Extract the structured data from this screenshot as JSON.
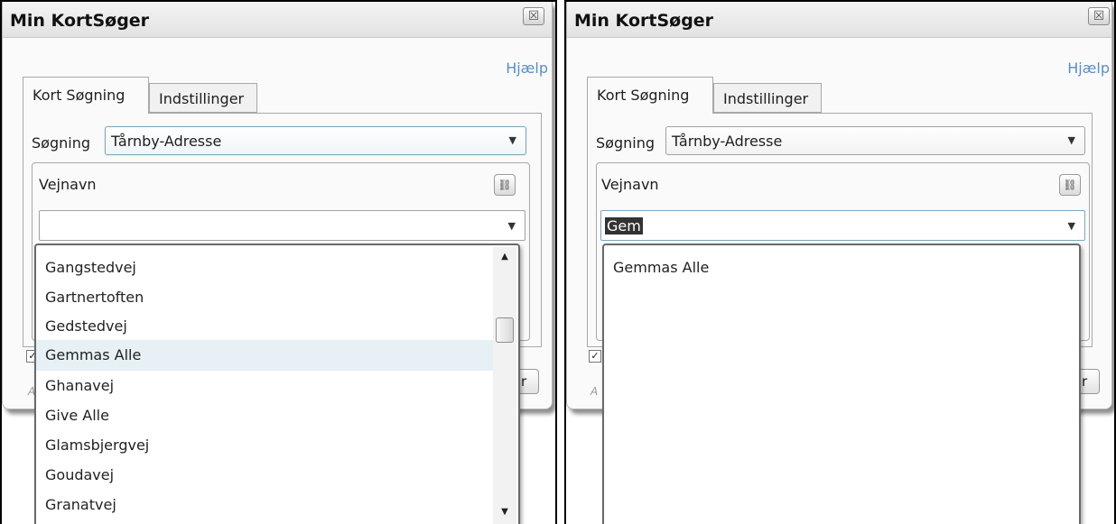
{
  "window_title": "Min KortSøger",
  "close_glyph": "☒",
  "help_link": "Hjælp",
  "tabs": [
    "Kort Søgning",
    "Indstillinger"
  ],
  "search_label": "Søgning",
  "search_select_value": "Tårnby-Adresse",
  "street_label": "Vejnavn",
  "checkbox_glyph": "✓",
  "partial_button_text": "r",
  "partial_hint_text": "A",
  "left_panel": {
    "street_input_value": "",
    "dropdown_items": [
      "Gangstedvej",
      "Gartnertoften",
      "Gedstedvej",
      "Gemmas Alle",
      "Ghanavej",
      "Give Alle",
      "Glamsbjergvej",
      "Goudavej",
      "Granatvej"
    ],
    "selected_item": "Gemmas Alle"
  },
  "right_panel": {
    "street_input_value": "Gem",
    "dropdown_items": [
      "Gemmas Alle"
    ]
  },
  "icons": {
    "close": "close-icon",
    "binoculars": "binoculars-icon",
    "dropdown_arrow": "chevron-down-icon",
    "scroll_up": "scroll-up-arrow-icon",
    "scroll_down": "scroll-down-arrow-icon"
  },
  "colors": {
    "help_link": "#5a8fc6",
    "selected_item_bg": "#e6f0f5",
    "select_border": "#7ba7bf"
  }
}
